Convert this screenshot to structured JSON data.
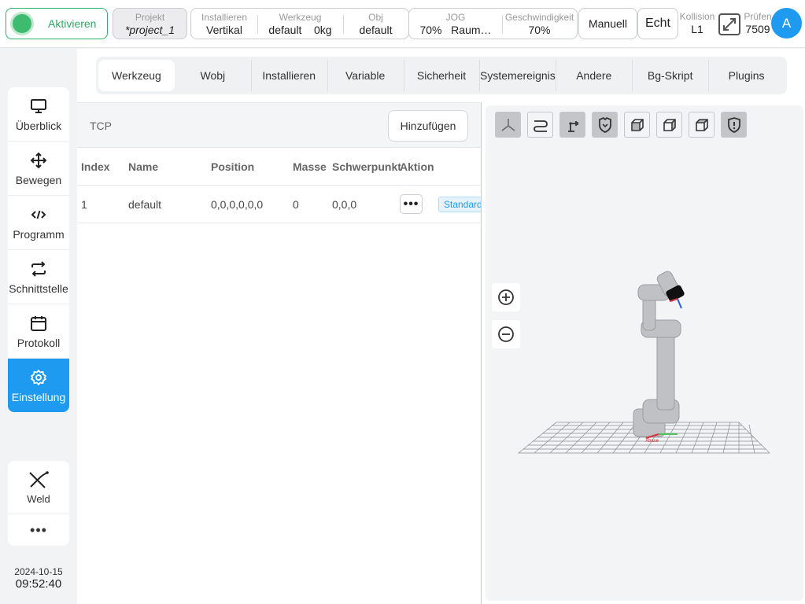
{
  "topbar": {
    "activate_label": "Aktivieren",
    "project": {
      "label": "Projekt",
      "value": "*project_1"
    },
    "install": {
      "label": "Installieren",
      "value": "Vertikal"
    },
    "tool": {
      "label": "Werkzeug",
      "name": "default",
      "load": "0kg"
    },
    "obj": {
      "label": "Obj",
      "value": "default"
    },
    "jog": {
      "label": "JOG",
      "percent": "70%",
      "mode": "Raum…"
    },
    "speed": {
      "label": "Geschwindigkeit",
      "value": "70%"
    },
    "manual_label": "Manuell",
    "real_label": "Echt",
    "collision": {
      "label": "Kollision",
      "value": "L1"
    },
    "check": {
      "label": "Prüfen",
      "value": "7509"
    },
    "avatar_letter": "A"
  },
  "sidebar": {
    "items": [
      {
        "label": "Überblick",
        "icon": "monitor-icon"
      },
      {
        "label": "Bewegen",
        "icon": "move-icon"
      },
      {
        "label": "Programm",
        "icon": "code-icon"
      },
      {
        "label": "Schnittstelle",
        "icon": "swap-icon"
      },
      {
        "label": "Protokoll",
        "icon": "calendar-icon"
      },
      {
        "label": "Einstellung",
        "icon": "gear-icon",
        "active": true
      }
    ],
    "weld_label": "Weld",
    "more_label": "•••",
    "date": "2024-10-15",
    "time": "09:52:40"
  },
  "tabs": [
    "Werkzeug",
    "Wobj",
    "Installieren",
    "Variable",
    "Sicherheit",
    "Systemereignis",
    "Andere",
    "Bg-Skript",
    "Plugins"
  ],
  "tcp": {
    "title": "TCP",
    "add_label": "Hinzufügen",
    "columns": {
      "index": "Index",
      "name": "Name",
      "position": "Position",
      "mass": "Masse",
      "cog": "Schwerpunkt",
      "action": "Aktion"
    },
    "rows": [
      {
        "index": "1",
        "name": "default",
        "position": "0,0,0,0,0,0",
        "mass": "0",
        "cog": "0,0,0",
        "badge": "Standard"
      }
    ]
  },
  "viewer": {
    "base_label": "Xbase",
    "accent_color": "#1e9bf0",
    "active_color": "#3dbb6e"
  }
}
